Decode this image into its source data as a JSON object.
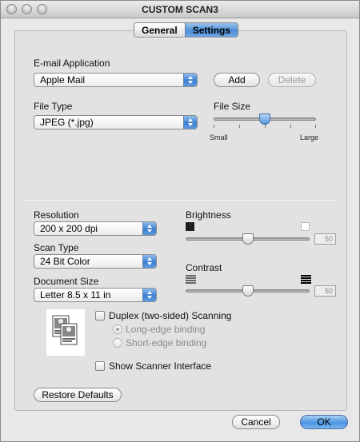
{
  "window": {
    "title": "CUSTOM SCAN3"
  },
  "tabs": [
    {
      "label": "General",
      "active": false
    },
    {
      "label": "Settings",
      "active": true
    }
  ],
  "email": {
    "label": "E-mail Application",
    "value": "Apple Mail",
    "add_label": "Add",
    "delete_label": "Delete"
  },
  "file_type": {
    "label": "File Type",
    "value": "JPEG (*.jpg)"
  },
  "file_size": {
    "label": "File Size",
    "min_label": "Small",
    "max_label": "Large",
    "level": 0.5
  },
  "resolution": {
    "label": "Resolution",
    "value": "200 x 200 dpi"
  },
  "scan_type": {
    "label": "Scan Type",
    "value": "24 Bit Color"
  },
  "document_size": {
    "label": "Document Size",
    "value": "Letter  8.5 x 11 in"
  },
  "brightness": {
    "label": "Brightness",
    "value": "50"
  },
  "contrast": {
    "label": "Contrast",
    "value": "50"
  },
  "duplex": {
    "label": "Duplex (two-sided) Scanning",
    "checked": false,
    "long_edge_label": "Long-edge binding",
    "short_edge_label": "Short-edge binding",
    "selected": "long-edge"
  },
  "scanner_interface": {
    "label": "Show Scanner Interface",
    "checked": false
  },
  "buttons": {
    "restore_label": "Restore Defaults",
    "cancel_label": "Cancel",
    "ok_label": "OK"
  },
  "colors": {
    "accent": "#4d8fd8",
    "panel": "#e2e2e2"
  }
}
